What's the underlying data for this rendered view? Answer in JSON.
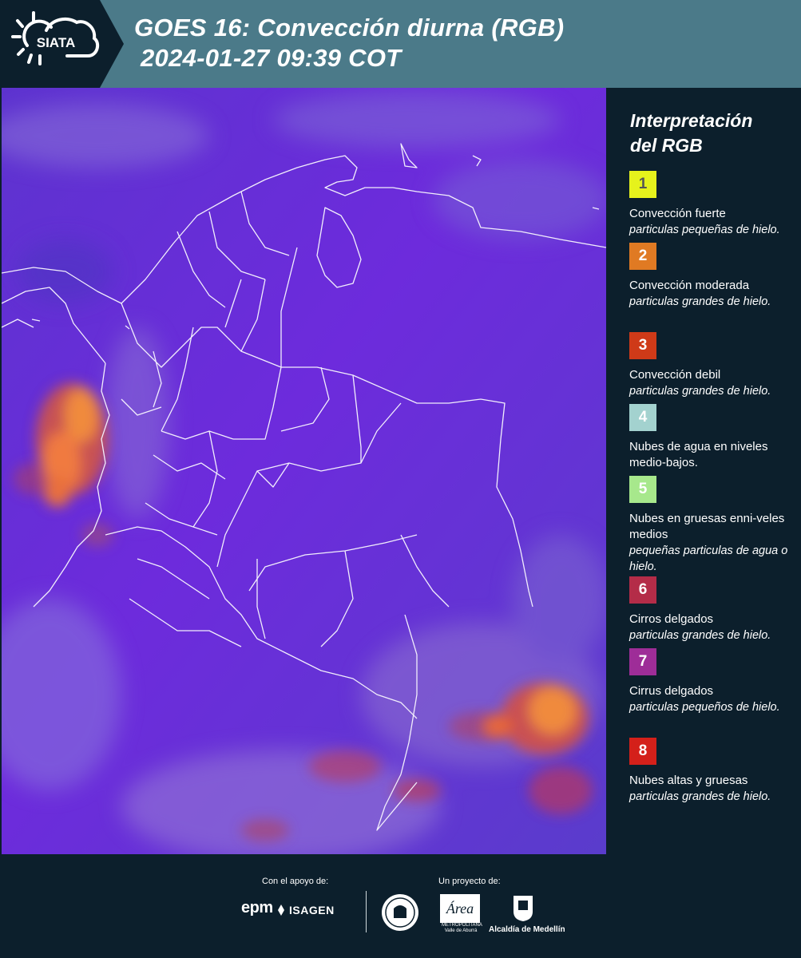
{
  "header": {
    "logo_text": "SIATA",
    "title_line1": "GOES 16: Convección diurna (RGB)",
    "title_line2": "2024-01-27 09:39 COT"
  },
  "colors": {
    "header_bg": "#4b7a89",
    "panel_bg": "#0c1f2c",
    "map_base": "#6b2bd6"
  },
  "legend": {
    "title_line1": "Interpretación",
    "title_line2": "del RGB",
    "items": [
      {
        "num": "1",
        "color": "#e6f21c",
        "numcolor": "#555555",
        "name": "Convección fuerte",
        "desc": "particulas pequeñas de hielo."
      },
      {
        "num": "2",
        "color": "#e07a23",
        "numcolor": "#ffffff",
        "name": "Convección moderada",
        "desc": "particulas grandes de hielo."
      },
      {
        "num": "3",
        "color": "#cf3a18",
        "numcolor": "#ffffff",
        "name": "Convección debil",
        "desc": "particulas grandes de hielo."
      },
      {
        "num": "4",
        "color": "#a3d2cf",
        "numcolor": "#ffffff",
        "name": "Nubes de agua en niveles medio-bajos.",
        "desc": ""
      },
      {
        "num": "5",
        "color": "#a7e88c",
        "numcolor": "#ffffff",
        "name": "Nubes en gruesas enni-veles medios",
        "desc": "pequeñas particulas de agua o hielo."
      },
      {
        "num": "6",
        "color": "#b42c48",
        "numcolor": "#ffffff",
        "name": "Cirros delgados",
        "desc": "particulas grandes de hielo."
      },
      {
        "num": "7",
        "color": "#9e2d98",
        "numcolor": "#ffffff",
        "name": "Cirrus delgados",
        "desc": "particulas pequeños de hielo."
      },
      {
        "num": "8",
        "color": "#d4201a",
        "numcolor": "#ffffff",
        "name": "Nubes altas y gruesas",
        "desc": "particulas grandes de hielo."
      }
    ]
  },
  "footer": {
    "support_label": "Con el apoyo de:",
    "project_label": "Un proyecto de:",
    "sponsor1": "epm",
    "sponsor2": "ISAGEN",
    "partner_area": "Área",
    "partner_area_sub": "METROPOLITANA Valle de Aburrá",
    "partner_alcaldia": "Alcaldía de Medellín"
  }
}
